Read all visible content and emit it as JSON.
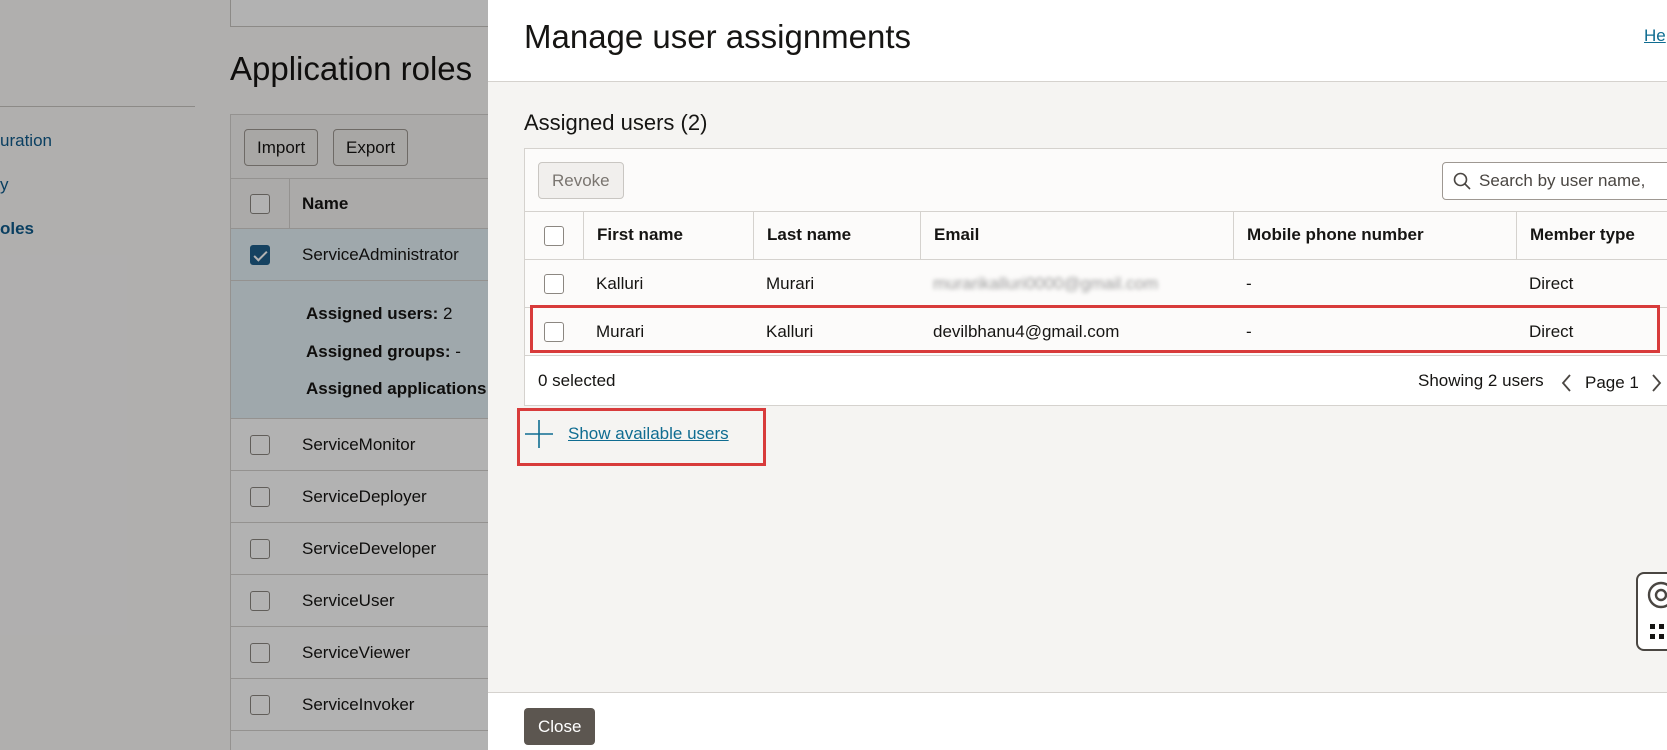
{
  "sidebar": {
    "items": [
      {
        "label": "uration"
      },
      {
        "label": "y"
      },
      {
        "label": "oles"
      }
    ]
  },
  "background": {
    "title": "Application roles",
    "toolbar": {
      "import_label": "Import",
      "export_label": "Export"
    },
    "table": {
      "header_name": "Name",
      "rows": [
        {
          "name": "ServiceAdministrator",
          "selected": true
        },
        {
          "name": "ServiceMonitor"
        },
        {
          "name": "ServiceDeployer"
        },
        {
          "name": "ServiceDeveloper"
        },
        {
          "name": "ServiceUser"
        },
        {
          "name": "ServiceViewer"
        },
        {
          "name": "ServiceInvoker"
        }
      ],
      "detail": {
        "assigned_users_label": "Assigned users:",
        "assigned_users_value": "2",
        "assigned_groups_label": "Assigned groups:",
        "assigned_groups_value": "-",
        "assigned_apps_label": "Assigned applications"
      }
    }
  },
  "drawer": {
    "title": "Manage user assignments",
    "help_label": "He",
    "section_title": "Assigned users (2)",
    "toolbar": {
      "revoke_label": "Revoke",
      "search_placeholder": "Search by user name,"
    },
    "columns": [
      "First name",
      "Last name",
      "Email",
      "Mobile phone number",
      "Member type"
    ],
    "rows": [
      {
        "first": "Kalluri",
        "last": "Murari",
        "email": "murarikalluri0000@gmail.com",
        "mobile": "-",
        "type": "Direct",
        "email_blurred": true
      },
      {
        "first": "Murari",
        "last": "Kalluri",
        "email": "devilbhanu4@gmail.com",
        "mobile": "-",
        "type": "Direct"
      }
    ],
    "footer": {
      "selected_text": "0 selected",
      "showing_text": "Showing 2 users",
      "page_text": "Page 1"
    },
    "show_available_label": "Show available users",
    "close_label": "Close"
  },
  "colors": {
    "link": "#0f6c91",
    "highlight": "#d83b3b",
    "checkbox_checked": "#1f5f8b"
  }
}
